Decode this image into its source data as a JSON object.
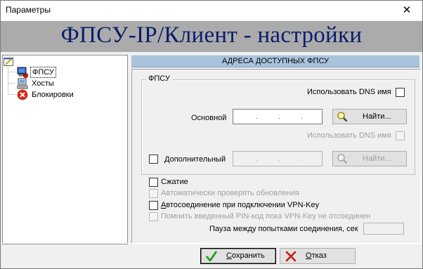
{
  "window": {
    "title": "Параметры",
    "close_glyph": "✕"
  },
  "banner": {
    "text": "ФПСУ-IP/Клиент - настройки",
    "color": "#0a1c6c",
    "background": "#ababab"
  },
  "tree": {
    "items": [
      {
        "label": "ФПСУ",
        "icon": "fpsu-computer-icon",
        "selected": true
      },
      {
        "label": "Хосты",
        "icon": "hosts-computer-icon",
        "selected": false
      },
      {
        "label": "Блокировки",
        "icon": "block-red-icon",
        "selected": false
      }
    ]
  },
  "section": {
    "header": "АДРЕСА ДОСТУПНЫХ ФПСУ",
    "header_color": "#a9c3dd"
  },
  "fpsu_group": {
    "title": "ФПСУ",
    "use_dns_primary_label": "Использовать DNS имя",
    "use_dns_secondary_label": "Использовать DNS имя",
    "primary_label": "Основной",
    "primary_ip": [
      ".",
      ".",
      "."
    ],
    "find_primary_label": "Найти...",
    "secondary_label": "Дополнительный",
    "secondary_ip": [
      ".",
      ".",
      "."
    ],
    "find_secondary_label": "Найти..."
  },
  "options": {
    "compression_label": "Сжатие",
    "auto_update_label": "Автоматически проверять обновления",
    "autoconnect_label_rest": "втосоединение при подключении VPN-Key",
    "autoconnect_accel": "А",
    "remember_pin_label": "Помнить введенный PIN-код пока VPN-Key не отсоединен",
    "pause_label": "Пауза между попытками соединения, сек"
  },
  "buttons": {
    "save_accel": "С",
    "save_rest": "охранить",
    "cancel_accel": "О",
    "cancel_rest": "тказ"
  }
}
